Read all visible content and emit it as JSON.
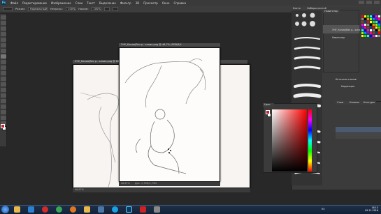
{
  "app": {
    "logo": "Ps"
  },
  "menu": [
    "Файл",
    "Редактирование",
    "Изображение",
    "Слои",
    "Текст",
    "Выделение",
    "Фильтр",
    "3D",
    "Просмотр",
    "Окно",
    "Справка"
  ],
  "options_bar": {
    "mode_label": "Режим:",
    "mode_value": "Нормальный",
    "opacity_label": "Непрозр.:",
    "opacity_value": "100%",
    "flow_label": "Нажим:",
    "flow_value": "100%"
  },
  "documents": [
    {
      "title": "ЭЧУ_Копия(Bez p.. копия.png @ 46,7% (RGB/8)*",
      "zoom": "46,67%",
      "info": "Док: 1,79М/1,79М"
    },
    {
      "title": "ЭЧУ_Копия(Bez p.. копия.png @ 66,7% (RGB/8)*",
      "zoom": "46,67%",
      "info": "Док: 1,79М/1,79М"
    }
  ],
  "panels": {
    "brush_tab": "Кисть",
    "brush_presets_tab": "Наборы кистей",
    "navigator_tab": "Навигатор",
    "navigator_doc": "ЭЧУ_Копия(Bez p.. копия.png",
    "navigator_layer": "Навигатор",
    "history_label": "Источник клонов",
    "history_item": "Коррекция",
    "color_tab": "Цвет",
    "layers_tab": "Слои",
    "channels_tab": "Каналы",
    "paths_tab": "Контуры"
  },
  "taskbar": {
    "tray_text": "RU",
    "time": "16:13",
    "date": "09.11.2016"
  },
  "colors": {
    "foreground": "#c0262b",
    "background": "#ffffff"
  }
}
